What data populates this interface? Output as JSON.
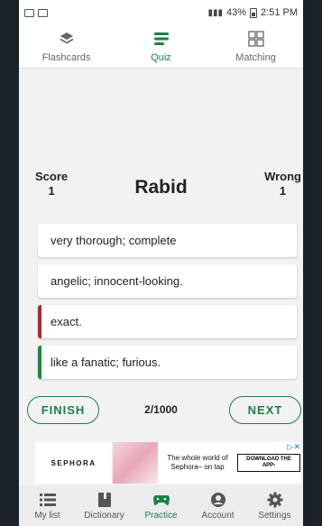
{
  "status": {
    "icons_left": [
      "image-icon",
      "activity-icon"
    ],
    "battery": "43%",
    "time": "2:51 PM"
  },
  "tabs": [
    {
      "label": "Flashcards",
      "icon": "layers-icon",
      "active": false
    },
    {
      "label": "Quiz",
      "icon": "menu-icon",
      "active": true
    },
    {
      "label": "Matching",
      "icon": "grid-icon",
      "active": false
    }
  ],
  "quiz": {
    "score_label": "Score",
    "score_value": "1",
    "wrong_label": "Wrong",
    "wrong_value": "1",
    "word": "Rabid",
    "answers": [
      {
        "text": "very thorough; complete",
        "state": "neutral"
      },
      {
        "text": "angelic; innocent-looking.",
        "state": "neutral"
      },
      {
        "text": "exact.",
        "state": "wrong"
      },
      {
        "text": "like a fanatic; furious.",
        "state": "correct"
      }
    ],
    "finish_label": "FINISH",
    "progress": "2/1000",
    "next_label": "NEXT"
  },
  "ad": {
    "brand": "SEPHORA",
    "text": "The whole world of Sephora– on tap",
    "cta": "DOWNLOAD THE APP›"
  },
  "nav": [
    {
      "label": "My list",
      "icon": "list-icon",
      "active": false
    },
    {
      "label": "Dictionary",
      "icon": "book-icon",
      "active": false
    },
    {
      "label": "Practice",
      "icon": "gamepad-icon",
      "active": true
    },
    {
      "label": "Account",
      "icon": "account-icon",
      "active": false
    },
    {
      "label": "Settings",
      "icon": "gear-icon",
      "active": false
    }
  ],
  "colors": {
    "accent": "#1b7f4a",
    "wrong": "#b02a2a",
    "correct": "#1b8a3a"
  }
}
